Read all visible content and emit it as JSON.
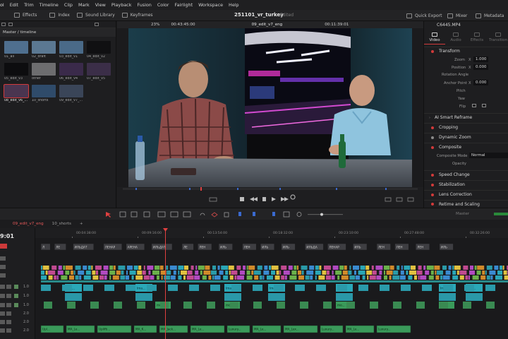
{
  "menu": [
    "ol",
    "Edit",
    "Trim",
    "Timeline",
    "Clip",
    "Mark",
    "View",
    "Playback",
    "Fusion",
    "Color",
    "Fairlight",
    "Workspace",
    "Help"
  ],
  "toolbar": {
    "effects": "Effects",
    "index": "Index",
    "sound_library": "Sound Library",
    "keyframes": "Keyframes",
    "quick_export": "Quick Export",
    "mixer": "Mixer",
    "metadata": "Metadata"
  },
  "project": {
    "title": "251101_vr_turkey",
    "status": "Edited"
  },
  "media_pool": {
    "path": "Master / timeline",
    "clips": [
      {
        "label": "01_all",
        "color": "#4f6f8f",
        "selected": false
      },
      {
        "label": "02_draft",
        "color": "#5b7892",
        "selected": false
      },
      {
        "label": "03_edit_v1",
        "color": "#4a6a88",
        "selected": false
      },
      {
        "label": "04_edit_v2",
        "color": "#101012",
        "selected": false
      },
      {
        "label": "05_edit_v3",
        "color": "#0d0d0f",
        "selected": false
      },
      {
        "label": "other",
        "color": "#6d6d6f",
        "selected": false
      },
      {
        "label": "06_edit_v4",
        "color": "#3a2a4a",
        "selected": false
      },
      {
        "label": "07_edit_v5",
        "color": "#3b2e48",
        "selected": false
      },
      {
        "label": "08_edit_v6_...",
        "color": "#4a3550",
        "selected": true
      },
      {
        "label": "10_shorts",
        "color": "#2f4b6a",
        "selected": false
      },
      {
        "label": "09_edit_v7_...",
        "color": "#3a4558",
        "selected": false
      }
    ]
  },
  "viewer": {
    "zoom": "23%",
    "source_tc": "00:43:45:00",
    "clip_name": "09_edit_v7_eng",
    "record_tc": "00:11:39:01"
  },
  "inspector": {
    "file": "C6445.MP4",
    "tabs": [
      "Video",
      "Audio",
      "Effects",
      "Transition"
    ],
    "transform": "Transform",
    "zoom_label": "Zoom",
    "zoom_x_label": "X",
    "zoom_x": "1.000",
    "position_label": "Position",
    "position_x_label": "X",
    "position_x": "0.000",
    "rotation_label": "Rotation Angle",
    "anchor_label": "Anchor Point",
    "anchor_x_label": "X",
    "anchor_x": "0.000",
    "pitch_label": "Pitch",
    "yaw_label": "Yaw",
    "flip_label": "Flip",
    "ai_smart": "AI Smart Reframe",
    "cropping": "Cropping",
    "dynamic_zoom": "Dynamic Zoom",
    "composite": "Composite",
    "composite_mode_label": "Composite Mode",
    "composite_mode": "Normal",
    "opacity_label": "Opacity",
    "speed_change": "Speed Change",
    "stabilization": "Stabilization",
    "lens_correction": "Lens Correction",
    "retime": "Retime and Scaling"
  },
  "timeline": {
    "tabs": [
      "09_edit_v7_eng",
      "10_shorts"
    ],
    "timecode": "9:01",
    "master": "Master",
    "ruler": [
      "00:04:38:00",
      "00:09:16:00",
      "00:13:54:00",
      "00:18:32:00",
      "00:23:10:00",
      "00:27:48:00",
      "00:32:26:00"
    ],
    "subtitle_cells": [
      "Л",
      "ЛЕ",
      "ИЛЬДАТ",
      "ЛЕНАР",
      "АРЕНА",
      "ИЛЬДАТ",
      "ЛЕ",
      "ЛЕН",
      "ИЛЬ",
      "ЛЕН",
      "ИЛЬ",
      "ИЛЬ",
      "ИЛЬДА",
      "ЛЕНАР",
      "ИЛЬ",
      "ЛЕН",
      "ЛЕН",
      "ЛЕН",
      "ИЛЬ"
    ],
    "video_labels": [
      "Ima...",
      "Ima...",
      "Ima...",
      "Ima...",
      "Ima...",
      "Ima...",
      "Ima..."
    ],
    "audio_labels": [
      "mo...",
      "mo...",
      "mo...",
      "mo..."
    ],
    "music_labels": [
      "Upl...",
      "MA_Le...",
      "Uplifti...",
      "MA_K...",
      "MA_Jack...",
      "MA_Le...",
      "Luxury...",
      "MA_Le...",
      "MA_Lex...",
      "Luxury...",
      "MA_Le...",
      "Luxury..."
    ],
    "track_levels": [
      "1.0",
      "1.0",
      "1.0",
      "2.0",
      "2.0",
      "2.0"
    ]
  }
}
